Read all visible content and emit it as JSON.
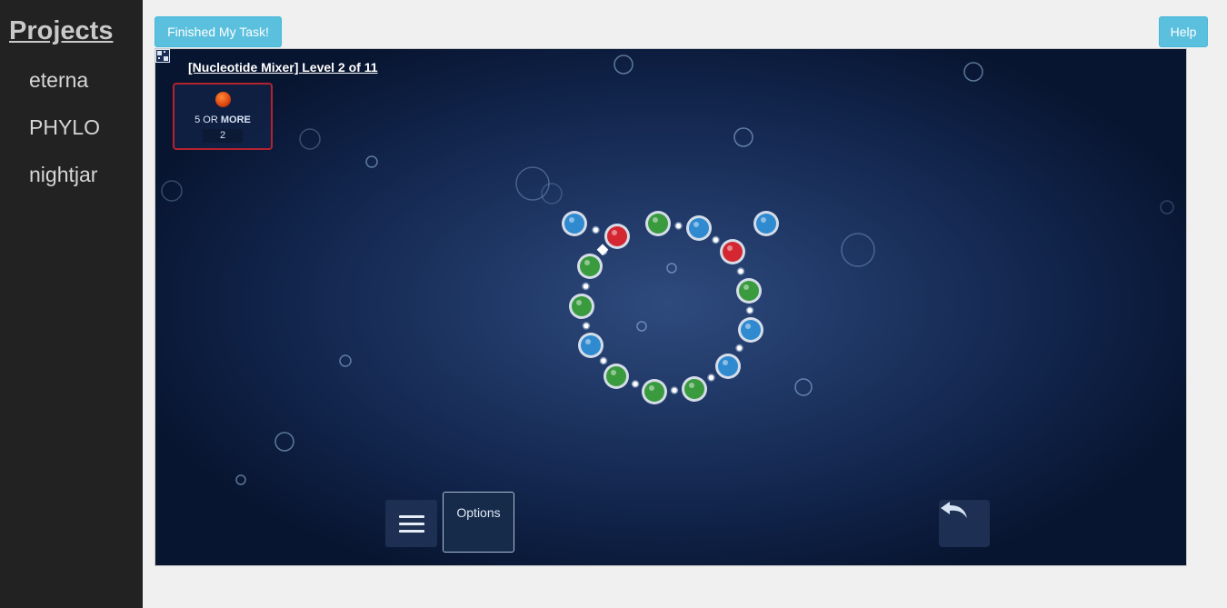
{
  "sidebar": {
    "title": "Projects",
    "items": [
      {
        "label": "eterna"
      },
      {
        "label": "PHYLO"
      },
      {
        "label": "nightjar"
      }
    ]
  },
  "toolbar": {
    "finished_label": "Finished My Task!",
    "help_label": "Help"
  },
  "game": {
    "puzzle_title": "[Nucleotide Mixer] Level 2 of 11",
    "constraint": {
      "prefix": "5 OR ",
      "emphasis": "MORE",
      "value": "2"
    },
    "options_label": "Options",
    "icons": {
      "puzzle": "puzzle-grid-icon",
      "menu": "hamburger-menu-icon",
      "undo": "undo-arrow-icon"
    },
    "colors": {
      "blue": "#2f8ad0",
      "red": "#d42731",
      "green": "#3a9a3e",
      "constraint_border": "#b2232f"
    },
    "sequence": [
      "blue",
      "red",
      "green",
      "green",
      "blue",
      "green",
      "green",
      "green",
      "blue",
      "blue",
      "green",
      "red",
      "blue",
      "blue",
      "green",
      "blue"
    ]
  }
}
